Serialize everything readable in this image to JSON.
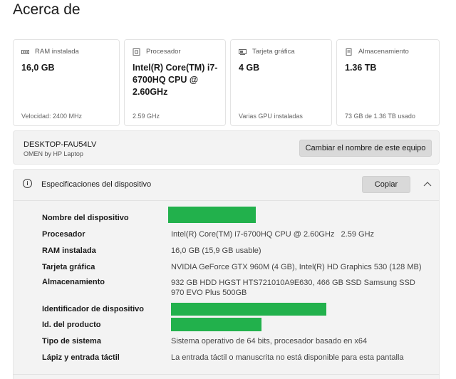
{
  "page": {
    "title": "Acerca de"
  },
  "cards": [
    {
      "label": "RAM instalada",
      "icon": "ram-icon",
      "value": "16,0 GB",
      "sub": "Velocidad: 2400 MHz"
    },
    {
      "label": "Procesador",
      "icon": "processor-icon",
      "value": "Intel(R) Core(TM) i7-6700HQ CPU @ 2.60GHz",
      "sub": "2.59 GHz"
    },
    {
      "label": "Tarjeta gráfica",
      "icon": "graphics-card-icon",
      "value": "4 GB",
      "sub": "Varias GPU instaladas"
    },
    {
      "label": "Almacenamiento",
      "icon": "storage-icon",
      "value": "1.36 TB",
      "sub": "73 GB de 1.36 TB usado"
    }
  ],
  "device": {
    "name": "DESKTOP-FAU54LV",
    "model": "OMEN by HP Laptop",
    "rename_label": "Cambiar el nombre de este equipo"
  },
  "specs": {
    "title": "Especificaciones del dispositivo",
    "copy_label": "Copiar",
    "rows": [
      {
        "label": "Nombre del dispositivo",
        "value": ""
      },
      {
        "label": "Procesador",
        "value": "Intel(R) Core(TM) i7-6700HQ CPU @ 2.60GHz   2.59 GHz"
      },
      {
        "label": "RAM instalada",
        "value": "16,0 GB (15,9 GB usable)"
      },
      {
        "label": "Tarjeta gráfica",
        "value": "NVIDIA GeForce GTX 960M (4 GB), Intel(R) HD Graphics 530 (128 MB)"
      },
      {
        "label": "Almacenamiento",
        "value": "932 GB HDD HGST HTS721010A9E630, 466 GB SSD Samsung SSD 970 EVO Plus 500GB"
      },
      {
        "label": "Identificador de dispositivo",
        "value": ""
      },
      {
        "label": "Id. del producto",
        "value": ""
      },
      {
        "label": "Tipo de sistema",
        "value": "Sistema operativo de 64 bits, procesador basado en x64"
      },
      {
        "label": "Lápiz y entrada táctil",
        "value": "La entrada táctil o manuscrita no está disponible para esta pantalla"
      }
    ]
  },
  "colors": {
    "redaction": "#22b14c",
    "panel_bg": "#f3f3f3",
    "button_bg": "#d9d9d9"
  }
}
